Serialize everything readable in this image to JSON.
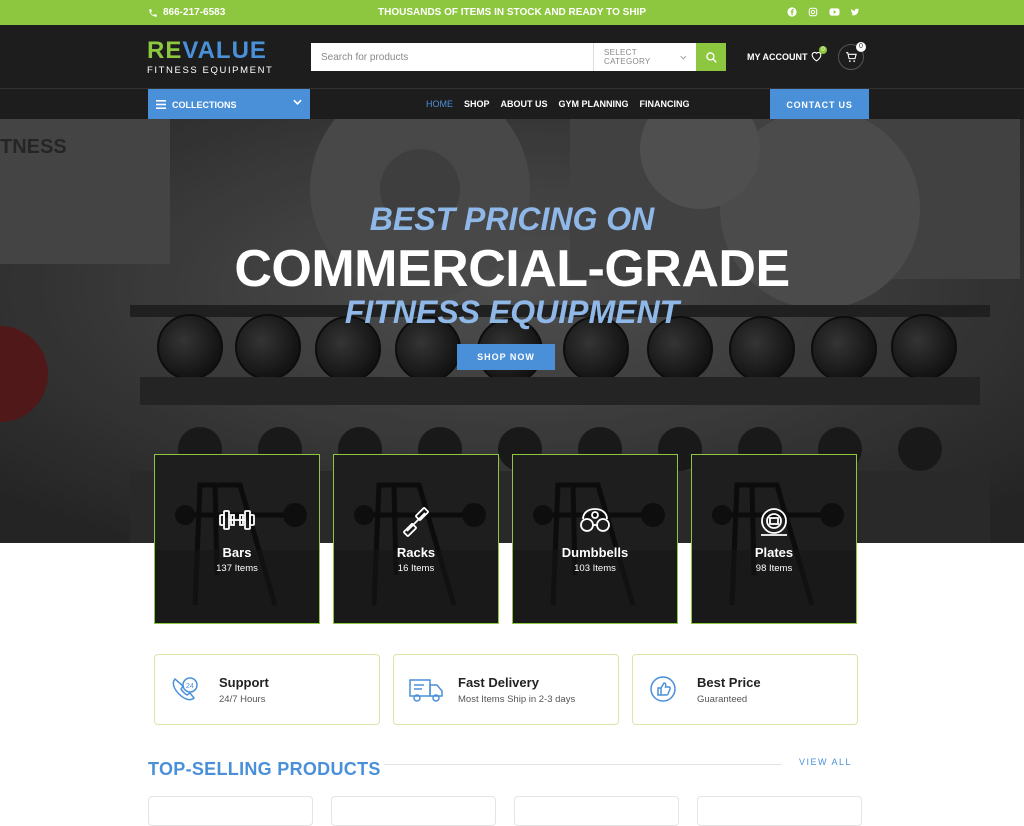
{
  "topbar": {
    "phone": "866-217-6583",
    "promo": "THOUSANDS OF ITEMS IN STOCK AND READY TO SHIP",
    "socials": [
      "facebook-icon",
      "instagram-icon",
      "youtube-icon",
      "twitter-icon"
    ]
  },
  "header": {
    "logo_main_a": "RE",
    "logo_main_b": "VALUE",
    "logo_sub": "FITNESS EQUIPMENT",
    "search_placeholder": "Search for products",
    "category": "SELECT CATEGORY",
    "account": "MY ACCOUNT",
    "wishlist_count": "0",
    "cart_count": "0"
  },
  "nav": {
    "collections": "COLLECTIONS",
    "items": [
      "HOME",
      "SHOP",
      "ABOUT US",
      "GYM PLANNING",
      "FINANCING"
    ],
    "contact": "CONTACT US"
  },
  "hero": {
    "line1": "BEST PRICING ON",
    "line2": "COMMERCIAL-GRADE",
    "line3": "FITNESS EQUIPMENT",
    "cta": "SHOP NOW"
  },
  "categories": [
    {
      "name": "Bars",
      "count": "137 Items"
    },
    {
      "name": "Racks",
      "count": "16 Items"
    },
    {
      "name": "Dumbbells",
      "count": "103 Items"
    },
    {
      "name": "Plates",
      "count": "98 Items"
    }
  ],
  "features": [
    {
      "title": "Support",
      "subtitle": "24/7 Hours"
    },
    {
      "title": "Fast Delivery",
      "subtitle": "Most Items Ship in 2-3 days"
    },
    {
      "title": "Best Price",
      "subtitle": "Guaranteed"
    }
  ],
  "section": {
    "title": "TOP-SELLING PRODUCTS",
    "view_all": "VIEW ALL"
  },
  "colors": {
    "accent_green": "#8dc63f",
    "accent_blue": "#4a90d9",
    "dark": "#1d1d1d"
  }
}
